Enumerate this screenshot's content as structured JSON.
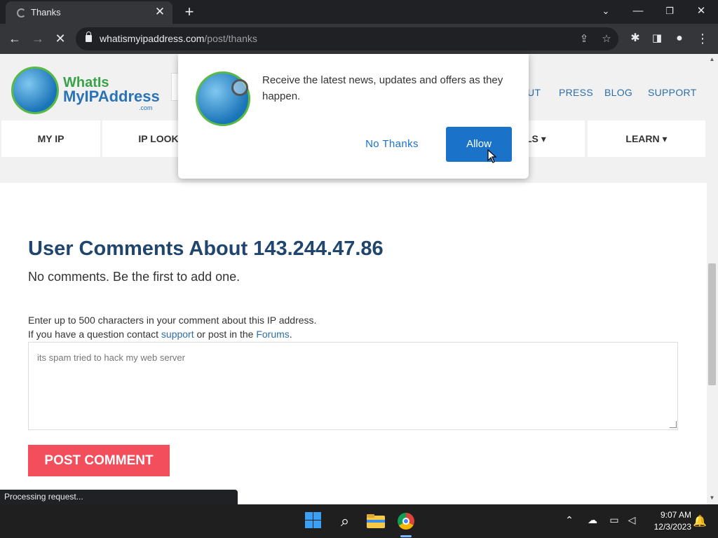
{
  "browser": {
    "tab_title": "Thanks",
    "url_host": "whatismyipaddress.com",
    "url_path": "/post/thanks"
  },
  "site": {
    "logo_line1": "WhatIs",
    "logo_line2": "MyIPAddress",
    "logo_suffix": ".com",
    "top_nav": [
      "UT",
      "PRESS",
      "BLOG",
      "SUPPORT"
    ],
    "main_nav": [
      "MY IP",
      "IP LOOK",
      "LS ▾",
      "LEARN ▾"
    ]
  },
  "popup": {
    "message": "Receive the latest news, updates and offers as they happen.",
    "no_thanks_label": "No Thanks",
    "allow_label": "Allow"
  },
  "content": {
    "title": "User Comments About 143.244.47.86",
    "no_comments": "No comments. Be the first to add one.",
    "hint_line1": "Enter up to 500 characters in your comment about this IP address.",
    "hint_line2_a": "If you have a question contact ",
    "hint_link_support": "support",
    "hint_line2_b": " or post in the ",
    "hint_link_forums": "Forums",
    "hint_line2_c": ".",
    "comment_value": "its spam tried to hack my web server",
    "post_button": "POST COMMENT"
  },
  "status_text": "Processing request...",
  "taskbar": {
    "time": "9:07 AM",
    "date": "12/3/2023"
  },
  "colors": {
    "accent": "#1a73c8",
    "post_button": "#f24e5b",
    "title": "#20466e"
  }
}
